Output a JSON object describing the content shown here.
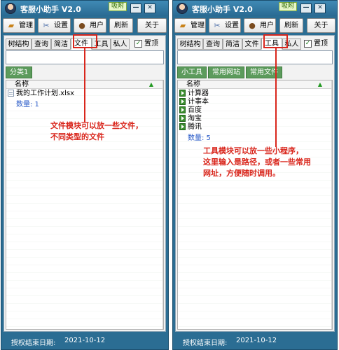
{
  "left_window": {
    "title": "客服小助手 V2.0",
    "badge": "吸附",
    "controls": [
      "—",
      "✕"
    ],
    "toolbar": {
      "manage": "管理",
      "settings": "设置",
      "user": "用户",
      "refresh": "刷新",
      "about": "关于"
    },
    "tabs": [
      "树结构",
      "查询",
      "简洁",
      "文件",
      "工具",
      "私人"
    ],
    "active_tab": "文件",
    "pin_label": "置顶",
    "pin_checked": true,
    "search_value": "",
    "categories": [
      "分类1"
    ],
    "list_header": "名称",
    "items": [
      {
        "name": "我的工作计划.xlsx",
        "icon": "file-icon"
      }
    ],
    "count_text": "数量: 1",
    "annotation": "文件模块可以放一些文件，\n不同类型的文件",
    "status_label": "授权结束日期:",
    "status_date": "2021-10-12"
  },
  "right_window": {
    "title": "客服小助手 V2.0",
    "badge": "吸附",
    "controls": [
      "—",
      "✕"
    ],
    "toolbar": {
      "manage": "管理",
      "settings": "设置",
      "user": "用户",
      "refresh": "刷新",
      "about": "关于"
    },
    "tabs": [
      "树结构",
      "查询",
      "简洁",
      "文件",
      "工具",
      "私人"
    ],
    "active_tab": "工具",
    "pin_label": "置顶",
    "pin_checked": true,
    "search_value": "",
    "categories": [
      "小工具",
      "常用网站",
      "常用文件"
    ],
    "list_header": "名称",
    "items": [
      {
        "name": "计算器",
        "icon": "launch-icon"
      },
      {
        "name": "计事本",
        "icon": "launch-icon"
      },
      {
        "name": "百度",
        "icon": "launch-icon"
      },
      {
        "name": "淘宝",
        "icon": "launch-icon"
      },
      {
        "name": "腾讯",
        "icon": "launch-icon"
      }
    ],
    "count_text": "数量: 5",
    "annotation": "工具模块可以放一些小程序，\n这里输入是路径，或者一些常用\n网址，方便随时调用。",
    "status_label": "授权结束日期:",
    "status_date": "2021-10-12"
  },
  "colors": {
    "window_frame": "#2b6d93",
    "annotation_red": "#d9261c",
    "category_green": "#5c9b5c",
    "count_blue": "#2a5bc8"
  }
}
